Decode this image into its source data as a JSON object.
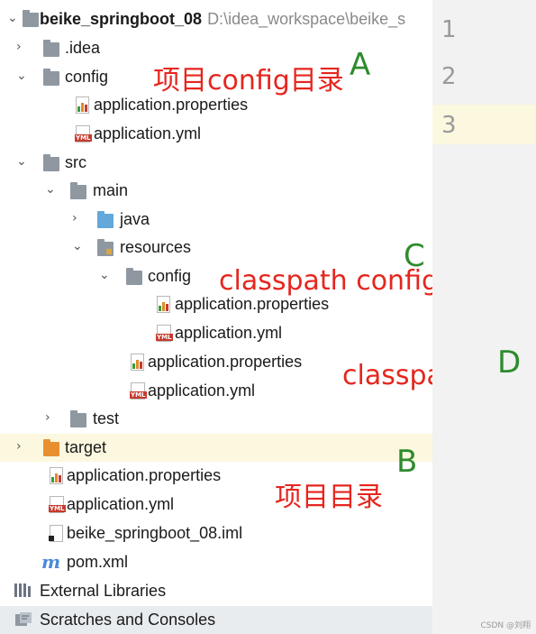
{
  "project": {
    "name": "beike_springboot_08",
    "path": "D:\\idea_workspace\\beike_s"
  },
  "line_numbers": [
    "1",
    "2",
    "3"
  ],
  "tree": {
    "idea": ".idea",
    "config": "config",
    "config_props": "application.properties",
    "config_yml": "application.yml",
    "src": "src",
    "main": "main",
    "java": "java",
    "resources": "resources",
    "res_config": "config",
    "res_config_props": "application.properties",
    "res_config_yml": "application.yml",
    "res_props": "application.properties",
    "res_yml": "application.yml",
    "test": "test",
    "target": "target",
    "root_props": "application.properties",
    "root_yml": "application.yml",
    "iml": "beike_springboot_08.iml",
    "pom": "pom.xml",
    "external_libraries": "External Libraries",
    "scratches": "Scratches and Consoles"
  },
  "icons": {
    "collapsed": "chevron-right-icon",
    "expanded": "chevron-down-icon",
    "maven": "m"
  },
  "annotations": {
    "a_text": "项目config目录",
    "a_letter": "A",
    "b_text": "项目目录",
    "b_letter": "B",
    "c_text": "classpath config目录",
    "c_letter": "C",
    "d_text": "classpath下",
    "d_letter": "D"
  },
  "colors": {
    "annotation_red": "#e5261f",
    "annotation_green": "#2e8b2e",
    "selection": "#fbf8df"
  },
  "watermark": "CSDN @刘翔"
}
